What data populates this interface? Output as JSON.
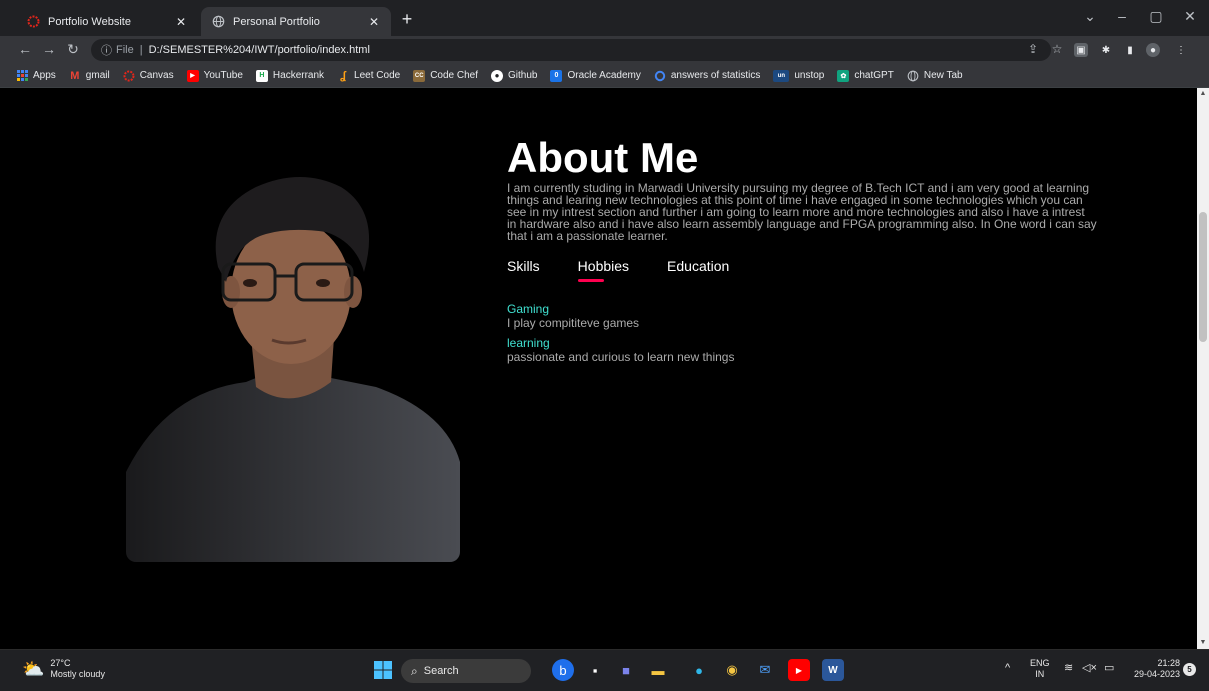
{
  "tabs": [
    {
      "title": "Portfolio Website",
      "icon": "canvas-icon",
      "active": false
    },
    {
      "title": "Personal Portfolio",
      "icon": "globe-icon",
      "active": true
    }
  ],
  "address": {
    "scheme": "File",
    "url": "D:/SEMESTER%204/IWT/portfolio/index.html"
  },
  "bookmarks": [
    {
      "label": "Apps",
      "icon": "apps-grid-icon",
      "color": "#4285f4"
    },
    {
      "label": "gmail",
      "icon": "gmail-icon",
      "color": "#ea4335"
    },
    {
      "label": "Canvas",
      "icon": "canvas-icon",
      "color": "#e4261b"
    },
    {
      "label": "YouTube",
      "icon": "youtube-icon",
      "color": "#ff0000"
    },
    {
      "label": "Hackerrank",
      "icon": "hackerrank-icon",
      "color": "#1ba94c"
    },
    {
      "label": "Leet Code",
      "icon": "leetcode-icon",
      "color": "#ffa116"
    },
    {
      "label": "Code Chef",
      "icon": "codechef-icon",
      "color": "#b47a3a"
    },
    {
      "label": "Github",
      "icon": "github-icon",
      "color": "#ffffff"
    },
    {
      "label": "Oracle Academy",
      "icon": "oracle-icon",
      "color": "#1a73e8"
    },
    {
      "label": "answers of statistics",
      "icon": "search-icon",
      "color": "#4285f4"
    },
    {
      "label": "unstop",
      "icon": "unstop-icon",
      "color": "#1c4980"
    },
    {
      "label": "chatGPT",
      "icon": "chatgpt-icon",
      "color": "#10a37f"
    },
    {
      "label": "New Tab",
      "icon": "globe-icon",
      "color": "#bdc1c6"
    }
  ],
  "page": {
    "heading": "About Me",
    "description": "I am currently studing in Marwadi University pursuing my degree of B.Tech ICT and i am very good at learning things and learing new technologies at this point of time i have engaged in some technologies which you can see in my intrest section and further i am going to learn more and more technologies and also i have a intrest in hardware also and i have also learn assembly language and FPGA programming also. In One word i can say that i am a passionate learner.",
    "tabs": [
      "Skills",
      "Hobbies",
      "Education"
    ],
    "active_tab": "Hobbies",
    "hobbies": [
      {
        "name": "Gaming",
        "detail": "I play compititeve games"
      },
      {
        "name": "learning",
        "detail": "passionate and curious to learn new things"
      }
    ],
    "accent_color": "#ff004f",
    "hobby_color": "#40e0d0"
  },
  "taskbar": {
    "weather_temp": "27°C",
    "weather_desc": "Mostly cloudy",
    "search_label": "Search",
    "lang_top": "ENG",
    "lang_bottom": "IN",
    "time": "21:28",
    "date": "29-04-2023",
    "notification_count": "5"
  }
}
